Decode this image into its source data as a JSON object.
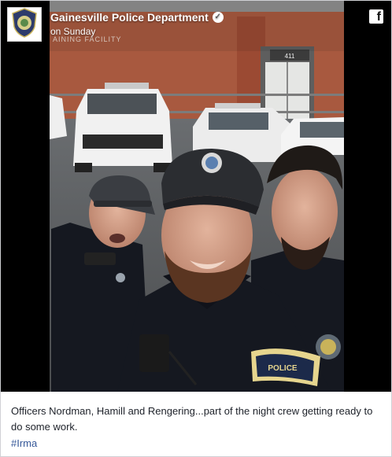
{
  "post": {
    "page_name": "Gainesville Police Department",
    "timestamp": "on Sunday",
    "caption": "Officers Nordman, Hamill and Rengering...part of the night crew getting ready to do some work.",
    "hashtag": "#Irma",
    "avatar_icon": "police-badge-icon",
    "verified_icon": "verified-check-icon",
    "social_icon": "facebook-icon",
    "fb_glyph": "f"
  },
  "photo": {
    "sign_text": "AINING FACILITY",
    "door_number": "411",
    "patch_text": "POLICE",
    "colors": {
      "building": "#a8593f",
      "uniform": "#151820",
      "cap": "#2b2d31",
      "sky": "#b9bcbc"
    }
  }
}
